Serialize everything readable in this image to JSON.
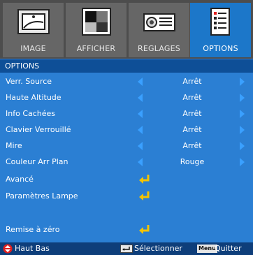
{
  "tabs": [
    {
      "label": "IMAGE",
      "icon": "image-icon"
    },
    {
      "label": "AFFICHER",
      "icon": "display-icon"
    },
    {
      "label": "REGLAGES",
      "icon": "projector-icon"
    },
    {
      "label": "OPTIONS",
      "icon": "options-icon",
      "active": true
    }
  ],
  "header": {
    "title": "OPTIONS"
  },
  "rows": [
    {
      "label": "Verr. Source",
      "value": "Arrêt"
    },
    {
      "label": "Haute Altitude",
      "value": "Arrêt"
    },
    {
      "label": "Info Cachées",
      "value": "Arrêt"
    },
    {
      "label": "Clavier Verrouillé",
      "value": "Arrêt"
    },
    {
      "label": "Mire",
      "value": "Arrêt"
    },
    {
      "label": "Couleur Arr Plan",
      "value": "Rouge"
    },
    {
      "label": "Avancé"
    },
    {
      "label": "Paramètres Lampe"
    },
    {
      "label": "Remise à zéro"
    }
  ],
  "footer": {
    "nav": "Haut Bas",
    "select": "Sélectionner",
    "menu_key": "Menu",
    "quit": "Quitter"
  },
  "colors": {
    "accent": "#1c77c9",
    "arrow": "#3aa0ff",
    "enter": "#f5c400"
  }
}
